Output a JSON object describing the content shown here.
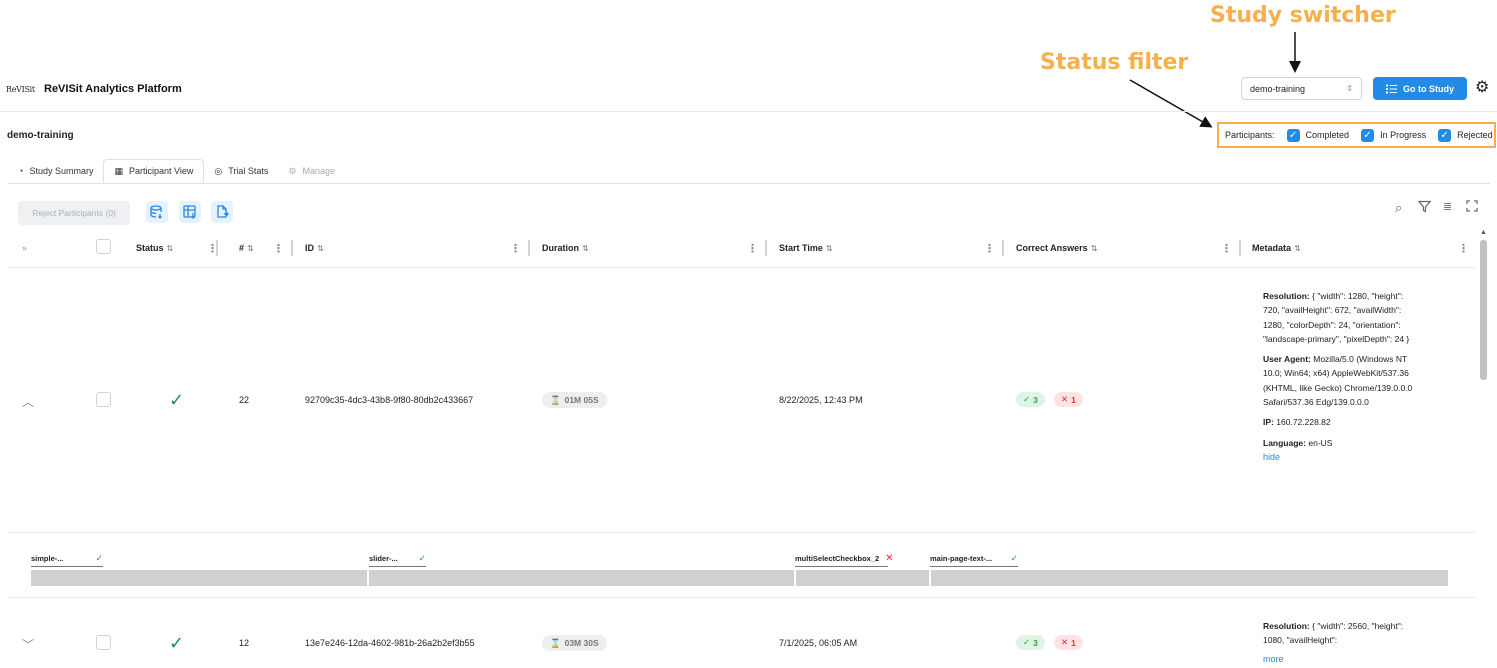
{
  "annotations": {
    "study_switcher": "Study switcher",
    "status_filter": "Status filter"
  },
  "header": {
    "logo_text": "ReVISit",
    "title": "ReVISit Analytics Platform",
    "study_select_value": "demo-training",
    "go_to_study_label": "Go to Study",
    "accent_color": "#228be6"
  },
  "study": {
    "name": "demo-training"
  },
  "filter": {
    "label": "Participants:",
    "options": [
      {
        "label": "Completed",
        "checked": true
      },
      {
        "label": "In Progress",
        "checked": true
      },
      {
        "label": "Rejected",
        "checked": true
      }
    ]
  },
  "tabs": [
    {
      "label": "Study Summary",
      "icon": "chart-pie-icon",
      "active": false
    },
    {
      "label": "Participant View",
      "icon": "table-icon",
      "active": true
    },
    {
      "label": "Trial Stats",
      "icon": "target-icon",
      "active": false
    },
    {
      "label": "Manage",
      "icon": "settings-icon",
      "active": false,
      "disabled": true
    }
  ],
  "toolbar": {
    "reject_label": "Reject Participants (0)"
  },
  "table": {
    "columns": [
      "Status",
      "#",
      "ID",
      "Duration",
      "Start Time",
      "Correct Answers",
      "Metadata"
    ],
    "rows": [
      {
        "expanded": true,
        "status": "completed",
        "number": "22",
        "id": "92709c35-4dc3-43b8-9f80-80db2c433667",
        "duration": "01M 05S",
        "start_time": "8/22/2025, 12:43 PM",
        "correct": "3",
        "incorrect": "1",
        "meta": {
          "resolution_label": "Resolution:",
          "resolution_value": "{ \"width\": 1280, \"height\": 720, \"availHeight\": 672, \"availWidth\": 1280, \"colorDepth\": 24, \"orientation\": \"landscape-primary\", \"pixelDepth\": 24 }",
          "ua_label": "User Agent:",
          "ua_value": "Mozilla/5.0 (Windows NT 10.0; Win64; x64) AppleWebKit/537.36 (KHTML, like Gecko) Chrome/139.0.0.0 Safari/537.36 Edg/139.0.0.0",
          "ip_label": "IP:",
          "ip_value": "160.72.228.82",
          "lang_label": "Language:",
          "lang_value": "en-US",
          "toggle": "hide"
        },
        "timeline": [
          {
            "label": "simple-...",
            "correct": true
          },
          {
            "label": "slider-...",
            "correct": true
          },
          {
            "label": "multiSelectCheckbox_2",
            "correct": false
          },
          {
            "label": "main-page-text-...",
            "correct": true
          }
        ]
      },
      {
        "expanded": false,
        "status": "completed",
        "number": "12",
        "id": "13e7e246-12da-4602-981b-26a2b2ef3b55",
        "duration": "03M 30S",
        "start_time": "7/1/2025, 06:05 AM",
        "correct": "3",
        "incorrect": "1",
        "meta": {
          "resolution_label": "Resolution:",
          "resolution_value": "{ \"width\": 2560, \"height\": 1080, \"availHeight\":",
          "toggle": "more"
        }
      }
    ]
  }
}
